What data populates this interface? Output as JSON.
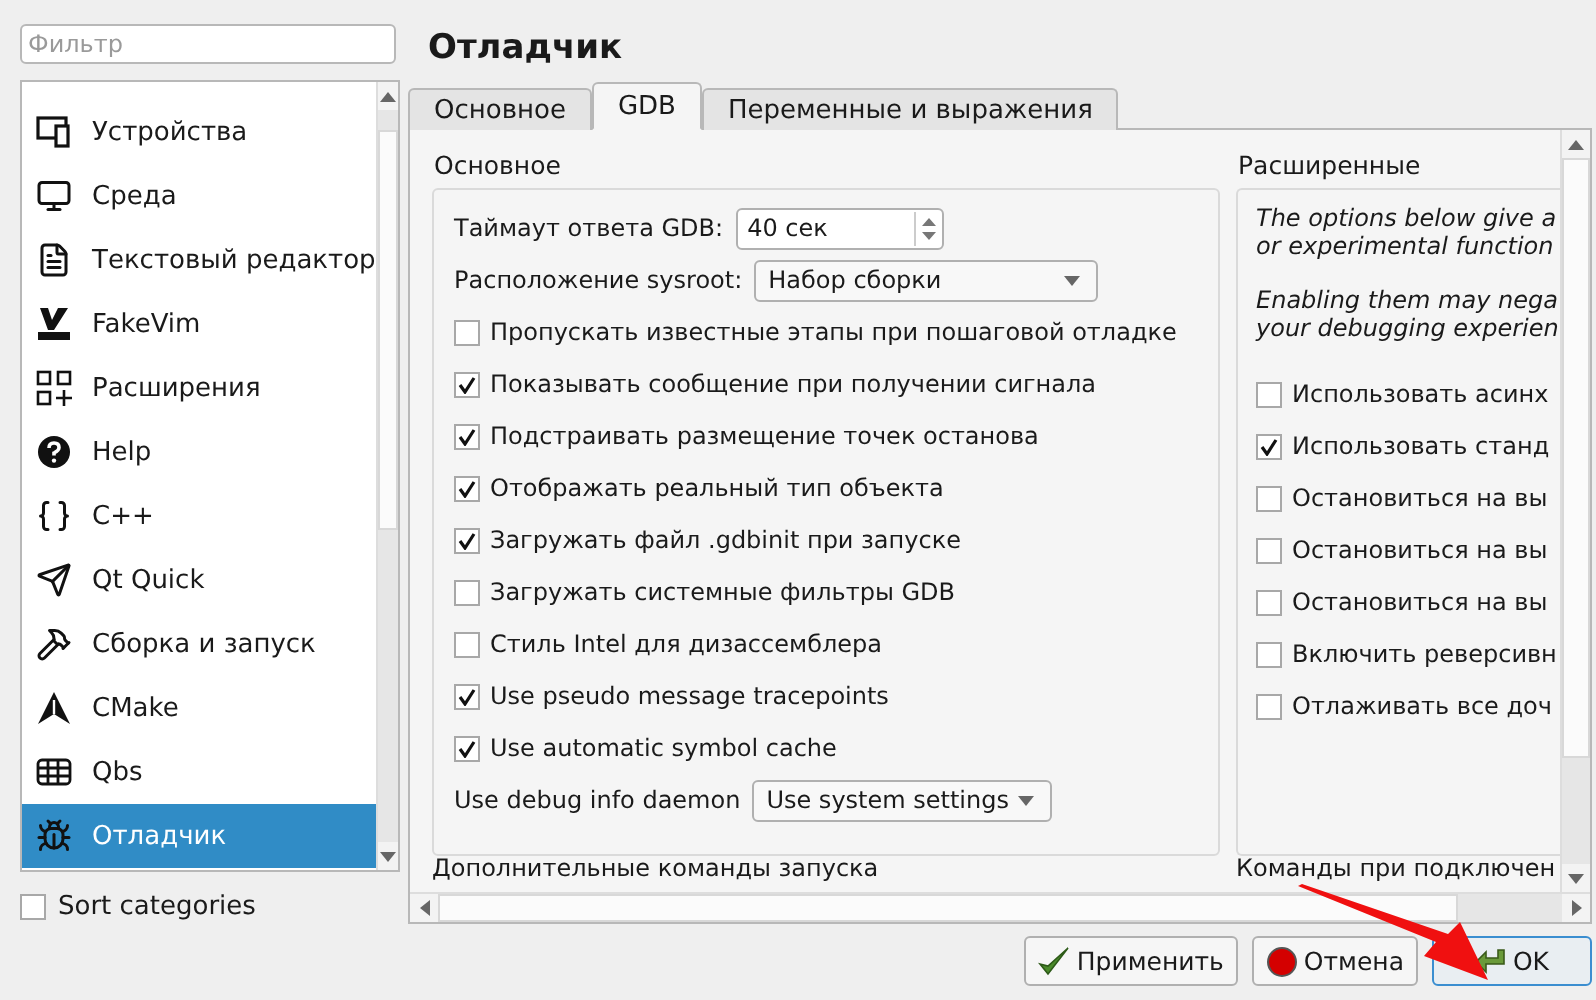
{
  "filter": {
    "placeholder": "Фильтр"
  },
  "categories": [
    {
      "label": "Устройства",
      "selected": false
    },
    {
      "label": "Среда",
      "selected": false
    },
    {
      "label": "Текстовый редактор",
      "selected": false
    },
    {
      "label": "FakeVim",
      "selected": false
    },
    {
      "label": "Расширения",
      "selected": false
    },
    {
      "label": "Help",
      "selected": false
    },
    {
      "label": "C++",
      "selected": false
    },
    {
      "label": "Qt Quick",
      "selected": false
    },
    {
      "label": "Сборка и запуск",
      "selected": false
    },
    {
      "label": "CMake",
      "selected": false
    },
    {
      "label": "Qbs",
      "selected": false
    },
    {
      "label": "Отладчик",
      "selected": true
    }
  ],
  "sort_categories": {
    "label": "Sort categories",
    "checked": false
  },
  "page_title": "Отладчик",
  "tabs": [
    {
      "label": "Основное",
      "selected": false
    },
    {
      "label": "GDB",
      "selected": true
    },
    {
      "label": "Переменные и выражения",
      "selected": false
    }
  ],
  "basic_group": {
    "title": "Основное",
    "timeout": {
      "label": "Таймаут ответа GDB:",
      "value": "40 сек"
    },
    "sysroot": {
      "label": "Расположение sysroot:",
      "value": "Набор сборки"
    },
    "options": [
      {
        "label": "Пропускать известные этапы при пошаговой отладке",
        "checked": false
      },
      {
        "label": "Показывать сообщение при получении сигнала",
        "checked": true
      },
      {
        "label": "Подстраивать размещение точек останова",
        "checked": true
      },
      {
        "label": "Отображать реальный тип объекта",
        "checked": true
      },
      {
        "label": "Загружать файл .gdbinit при запуске",
        "checked": true
      },
      {
        "label": "Загружать системные фильтры GDB",
        "checked": false
      },
      {
        "label": "Стиль Intel для дизассемблера",
        "checked": false
      },
      {
        "label": "Use pseudo message tracepoints",
        "checked": true
      },
      {
        "label": "Use automatic symbol cache",
        "checked": true
      }
    ],
    "debuginfod": {
      "label": "Use debug info daemon",
      "value": "Use system settings"
    }
  },
  "advanced_group": {
    "title": "Расширенные",
    "paragraphs": [
      [
        "The options below give a",
        "or experimental function"
      ],
      [
        "Enabling them may nega",
        "your debugging experien"
      ]
    ],
    "options": [
      {
        "label": "Использовать асинх",
        "checked": false
      },
      {
        "label": "Использовать станд",
        "checked": true
      },
      {
        "label": "Остановиться на вы",
        "checked": false
      },
      {
        "label": "Остановиться на вы",
        "checked": false
      },
      {
        "label": "Остановиться на вы",
        "checked": false
      },
      {
        "label": "Включить реверсивн",
        "checked": false
      },
      {
        "label": "Отлаживать все доч",
        "checked": false
      }
    ]
  },
  "extra_commands_label": "Дополнительные команды запуска",
  "attach_commands_label": "Команды при подключен",
  "buttons": [
    {
      "label": "Применить",
      "kind": "apply"
    },
    {
      "label": "Отмена",
      "kind": "cancel"
    },
    {
      "label": "OK",
      "kind": "ok"
    }
  ]
}
